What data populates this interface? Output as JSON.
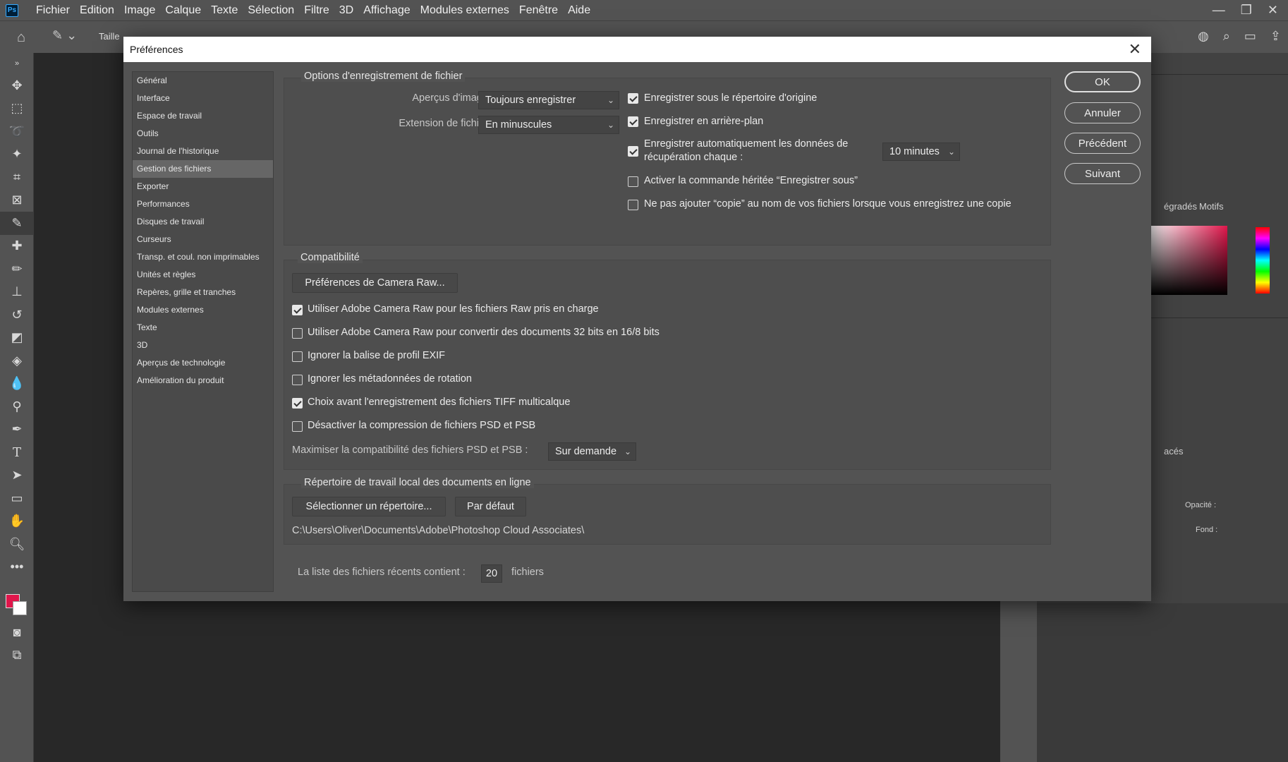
{
  "app": {
    "logo": "Ps",
    "menu": [
      "Fichier",
      "Edition",
      "Image",
      "Calque",
      "Texte",
      "Sélection",
      "Filtre",
      "3D",
      "Affichage",
      "Modules externes",
      "Fenêtre",
      "Aide"
    ],
    "options_bar": {
      "size_label": "Taille"
    },
    "right_panels": {
      "tab_gradients": "égradés",
      "tab_patterns": "Motifs",
      "tab_layers": "acés",
      "opacity_label": "Opacité :",
      "fill_label": "Fond :"
    }
  },
  "dialog": {
    "title": "Préférences",
    "nav": [
      "Général",
      "Interface",
      "Espace de travail",
      "Outils",
      "Journal de l'historique",
      "Gestion des fichiers",
      "Exporter",
      "Performances",
      "Disques de travail",
      "Curseurs",
      "Transp. et coul. non imprimables",
      "Unités et règles",
      "Repères, grille et tranches",
      "Modules externes",
      "Texte",
      "3D",
      "Aperçus de technologie",
      "Amélioration du produit"
    ],
    "nav_active": "Gestion des fichiers",
    "buttons": {
      "ok": "OK",
      "cancel": "Annuler",
      "prev": "Précédent",
      "next": "Suivant"
    },
    "save_options": {
      "title": "Options d'enregistrement de fichier",
      "previews_label": "Aperçus d'image :",
      "previews_value": "Toujours enregistrer",
      "extension_label": "Extension de fichier :",
      "extension_value": "En minuscules",
      "save_in_original": "Enregistrer sous le répertoire d'origine",
      "save_background": "Enregistrer en arrière-plan",
      "autosave_line1": "Enregistrer automatiquement les données de",
      "autosave_line2": "récupération  chaque :",
      "autosave_value": "10 minutes",
      "legacy_save_as": "Activer la commande héritée “Enregistrer sous”",
      "no_copy": "Ne pas ajouter “copie” au nom de vos fichiers lorsque vous enregistrez une copie",
      "checked": {
        "save_in_original": true,
        "save_background": true,
        "autosave": true,
        "legacy_save_as": false,
        "no_copy": false
      }
    },
    "compat": {
      "title": "Compatibilité",
      "camera_raw_btn": "Préférences de Camera Raw...",
      "opt1": "Utiliser Adobe Camera Raw pour les fichiers Raw pris en charge",
      "opt2": "Utiliser Adobe Camera Raw pour convertir des documents 32 bits en 16/8 bits",
      "opt3": "Ignorer la balise de profil EXIF",
      "opt4": "Ignorer les métadonnées de rotation",
      "opt5": "Choix avant l'enregistrement des fichiers TIFF multicalque",
      "opt6": "Désactiver la compression de fichiers PSD et PSB",
      "checked": [
        true,
        false,
        false,
        false,
        true,
        false
      ],
      "maximize_label": "Maximiser la compatibilité des fichiers PSD et PSB :",
      "maximize_value": "Sur demande"
    },
    "cloud": {
      "title": "Répertoire de travail local des documents en ligne",
      "select_btn": "Sélectionner un répertoire...",
      "default_btn": "Par défaut",
      "path": "C:\\Users\\Oliver\\Documents\\Adobe\\Photoshop Cloud Associates\\"
    },
    "recent": {
      "label": "La liste des fichiers récents contient :",
      "value": "20",
      "suffix": "fichiers"
    }
  }
}
